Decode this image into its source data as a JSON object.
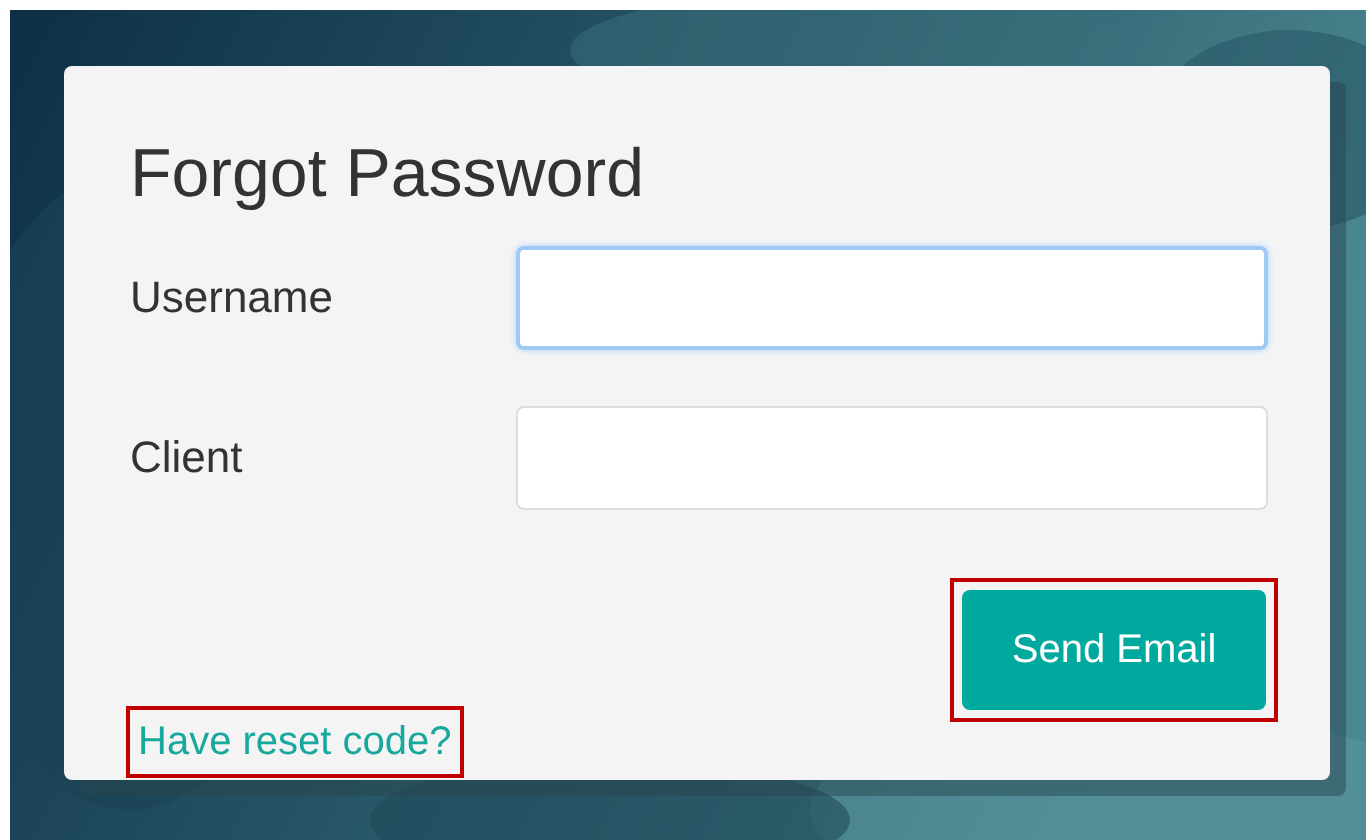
{
  "dialog": {
    "title": "Forgot Password",
    "fields": [
      {
        "label": "Username",
        "focused": true
      },
      {
        "label": "Client",
        "focused": false
      }
    ],
    "link": {
      "text": "Have reset code?",
      "highlighted": true
    },
    "button": {
      "text": "Send Email",
      "highlighted": true
    }
  }
}
